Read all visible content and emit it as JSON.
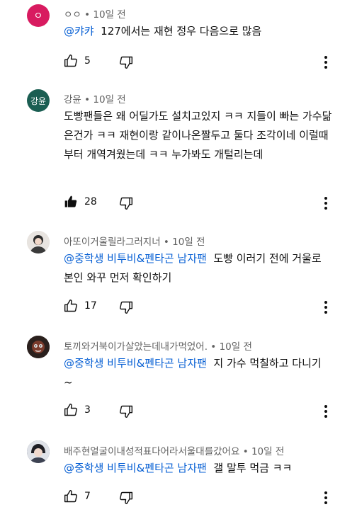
{
  "comments": [
    {
      "author": "ㅇㅇ",
      "time": "10일 전",
      "avatar_text": "ㅇ",
      "avatar_color": "#d81b60",
      "mention": "@캬캬",
      "text": "127에서는 재현 정우 다음으로 많음",
      "likes": "5",
      "liked": false
    },
    {
      "author": "강윤",
      "time": "10일 전",
      "avatar_text": "강윤",
      "avatar_color": "#1b5e52",
      "mention": "",
      "text": "도빵팬들은 왜 어딜가도 설치고있지 ㅋㅋ 지들이 빠는 가수닮은건가 ㅋㅋ 재현이랑 같이나온짤두고 둘다 조각이네 이럴때부터 개역겨웠는데 ㅋㅋ 누가봐도 개털리는데",
      "likes": "28",
      "liked": true
    },
    {
      "author": "아또이거울릴라그러지너",
      "time": "10일 전",
      "avatar_text": "",
      "avatar_color": "#cfc9c4",
      "mention": "@중학생 비투비&펜타곤 남자팬",
      "text": "도빵 이러기 전에 거울로 본인 와꾸 먼저 확인하기",
      "likes": "17",
      "liked": false
    },
    {
      "author": "토끼와거북이가살았는데내가먹었어.",
      "time": "10일 전",
      "avatar_text": "",
      "avatar_color": "#3a2a26",
      "mention": "@중학생 비투비&펜타곤 남자팬",
      "text": "지 가수 먹칠하고 다니기~",
      "likes": "3",
      "liked": false
    },
    {
      "author": "배주현얼굴이내성적표다어라서울대를갔어요",
      "time": "10일 전",
      "avatar_text": "",
      "avatar_color": "#4a4f5c",
      "mention": "@중학생 비투비&펜타곤 남자팬",
      "text": "갤 말투 먹금 ㅋㅋ",
      "likes": "7",
      "liked": false
    }
  ],
  "separator": " • "
}
